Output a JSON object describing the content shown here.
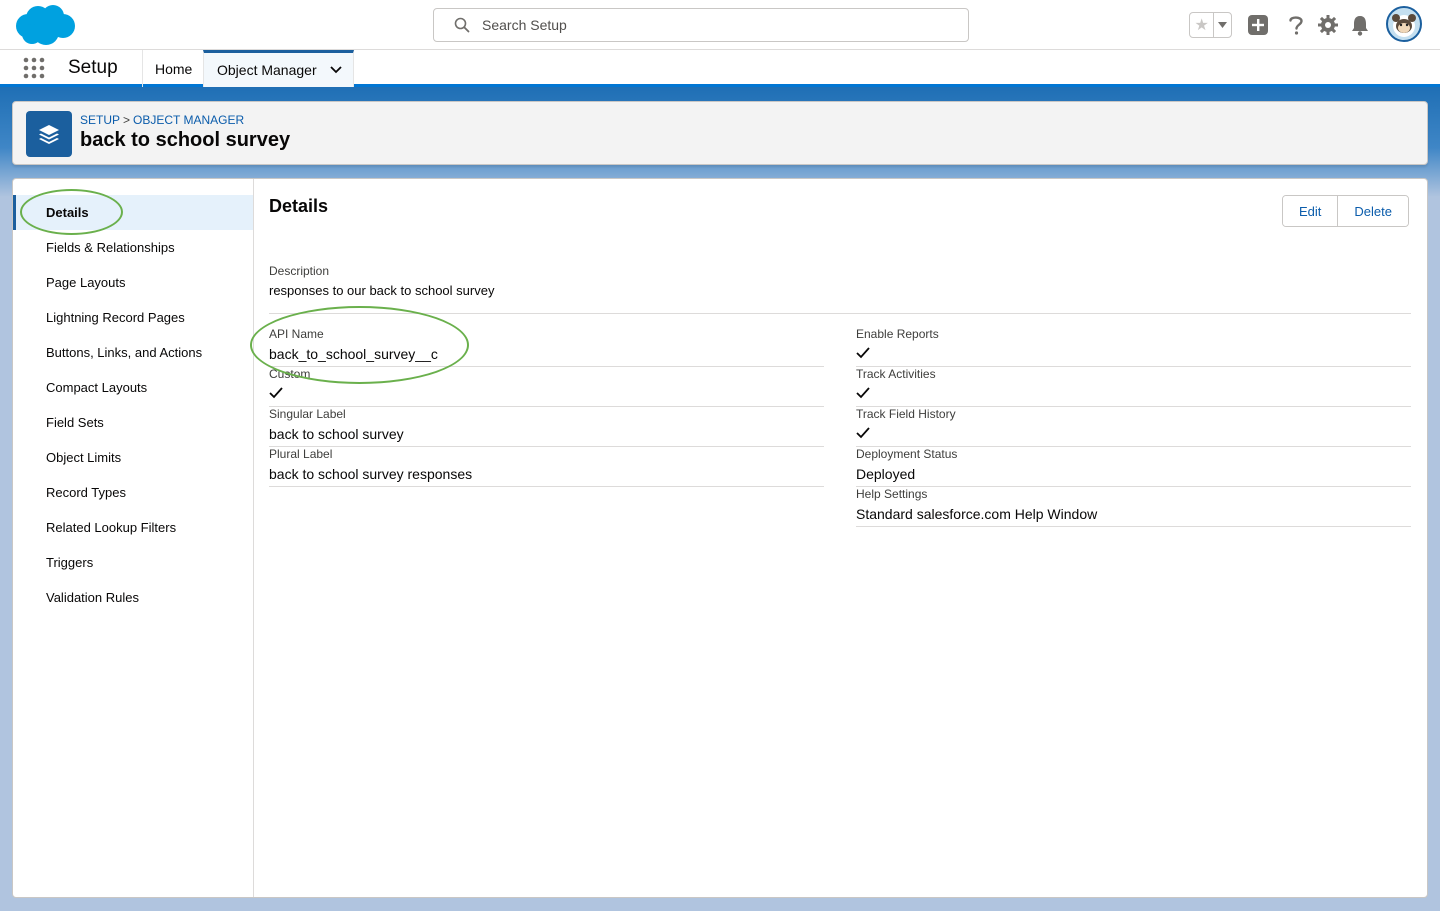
{
  "header": {
    "search_placeholder": "Search Setup",
    "icons": [
      "salesforce-cloud-logo",
      "search-icon",
      "favorites-star-icon",
      "chevron-down-icon",
      "plus-icon",
      "help-icon",
      "gear-icon",
      "bell-icon",
      "avatar"
    ]
  },
  "app_bar": {
    "app_name": "Setup",
    "tabs": [
      {
        "label": "Home"
      },
      {
        "label": "Object Manager"
      }
    ]
  },
  "page_header": {
    "breadcrumb_setup": "SETUP",
    "breadcrumb_separator": ">",
    "breadcrumb_object_manager": "OBJECT MANAGER",
    "title": "back to school survey"
  },
  "sidebar": {
    "items": [
      {
        "label": "Details"
      },
      {
        "label": "Fields & Relationships"
      },
      {
        "label": "Page Layouts"
      },
      {
        "label": "Lightning Record Pages"
      },
      {
        "label": "Buttons, Links, and Actions"
      },
      {
        "label": "Compact Layouts"
      },
      {
        "label": "Field Sets"
      },
      {
        "label": "Object Limits"
      },
      {
        "label": "Record Types"
      },
      {
        "label": "Related Lookup Filters"
      },
      {
        "label": "Triggers"
      },
      {
        "label": "Validation Rules"
      }
    ]
  },
  "details": {
    "title": "Details",
    "edit_label": "Edit",
    "delete_label": "Delete",
    "description": {
      "label": "Description",
      "value": "responses to our back to school survey"
    },
    "left": [
      {
        "label": "API Name",
        "value": "back_to_school_survey__c"
      },
      {
        "label": "Custom",
        "checked": true
      },
      {
        "label": "Singular Label",
        "value": "back to school survey"
      },
      {
        "label": "Plural Label",
        "value": "back to school survey responses"
      }
    ],
    "right": [
      {
        "label": "Enable Reports",
        "checked": true
      },
      {
        "label": "Track Activities",
        "checked": true
      },
      {
        "label": "Track Field History",
        "checked": true
      },
      {
        "label": "Deployment Status",
        "value": "Deployed"
      },
      {
        "label": "Help Settings",
        "value": "Standard salesforce.com Help Window"
      }
    ]
  },
  "colors": {
    "brand": "#0176d3",
    "link": "#0b5cab",
    "highlight": "#6ab04c"
  }
}
